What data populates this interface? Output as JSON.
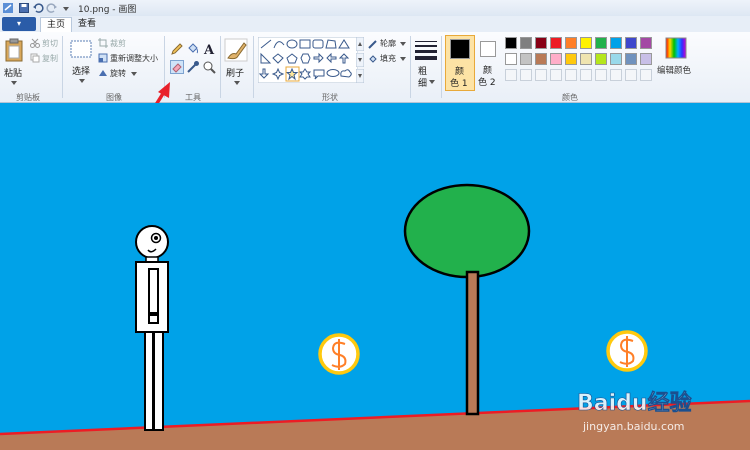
{
  "window": {
    "title": "10.png - 画图"
  },
  "tabs": {
    "file": "▾",
    "home": "主页",
    "view": "查看"
  },
  "clipboard": {
    "paste": "粘贴",
    "cut": "剪切",
    "copy": "复制",
    "label": "剪贴板"
  },
  "image": {
    "select": "选择",
    "crop": "裁剪",
    "resize": "重新调整大小",
    "rotate": "旋转",
    "label": "图像"
  },
  "tools": {
    "label": "工具",
    "text_tool": "A"
  },
  "brushes": {
    "label": "刷子"
  },
  "shapes": {
    "outline": "轮廓",
    "fill": "填充",
    "label": "形状"
  },
  "size": {
    "label_line1": "粗",
    "label_line2": "细"
  },
  "colors": {
    "color1_line1": "颜",
    "color1_line2": "色 1",
    "color2_line1": "颜",
    "color2_line2": "色 2",
    "edit": "编辑颜色",
    "label": "颜色",
    "color1_value": "#000000",
    "color2_value": "#ffffff",
    "palette_row1": [
      "#000000",
      "#7f7f7f",
      "#880015",
      "#ed1c24",
      "#ff7f27",
      "#fff200",
      "#22b14c",
      "#00a2e8",
      "#3f48cc",
      "#a349a4"
    ],
    "palette_row2": [
      "#ffffff",
      "#c3c3c3",
      "#b97a57",
      "#ffaec9",
      "#ffc90e",
      "#efe4b0",
      "#b5e61d",
      "#99d9ea",
      "#7092be",
      "#c8bfe7"
    ]
  },
  "canvas": {
    "sky": "#00a2e8",
    "ground": "#b97a57",
    "ground_line": "#ed1c24",
    "tree_crown": "#22b14c",
    "tree_trunk": "#b97a57",
    "coin_fill": "#ffffff",
    "coin_ring": "#ffc90e",
    "coin_symbol_color": "#ff7f27"
  },
  "watermark": {
    "logo_text": "Baidu经验",
    "url": "jingyan.baidu.com"
  }
}
